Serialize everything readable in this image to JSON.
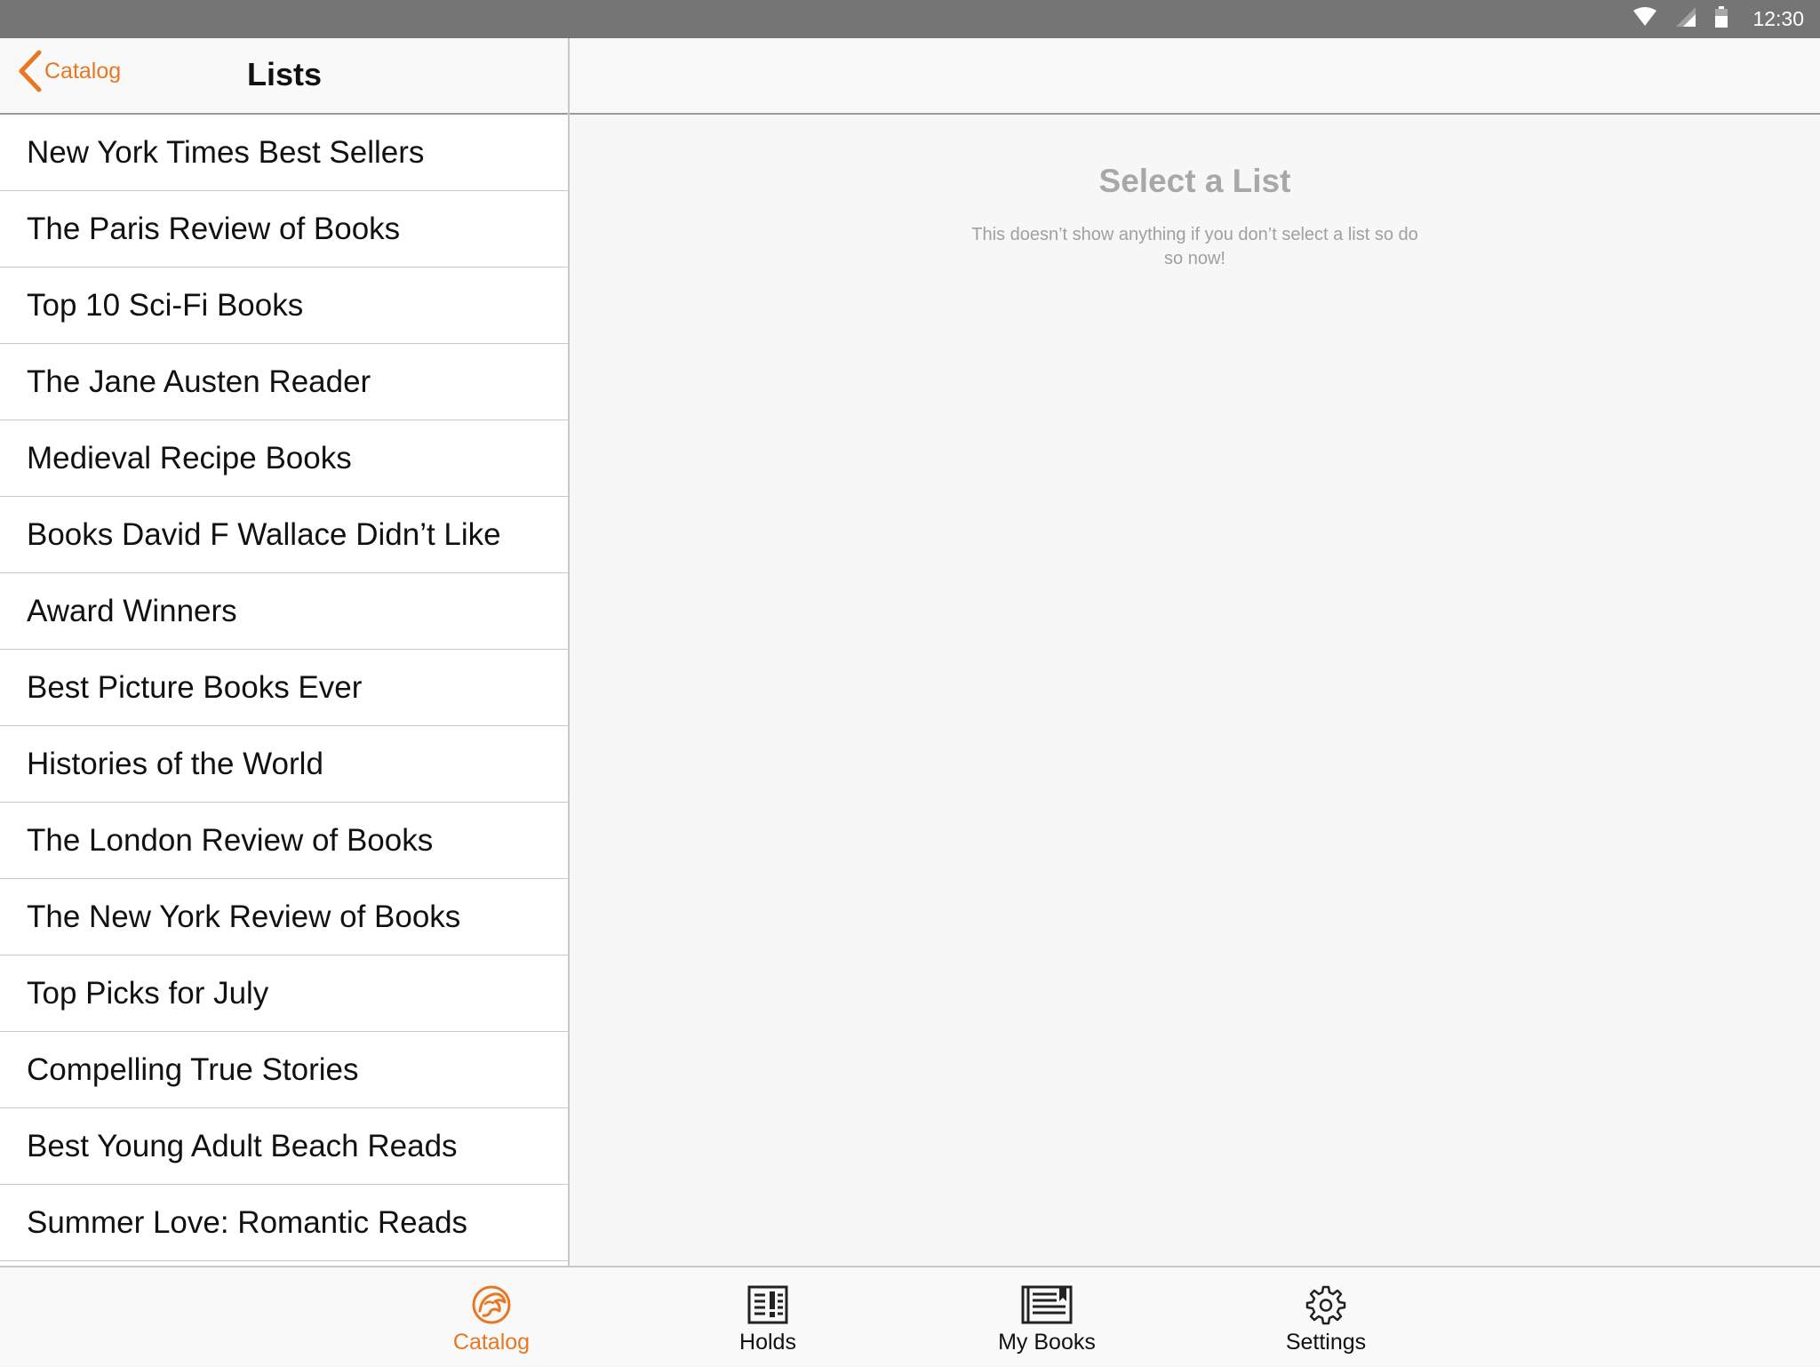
{
  "status_bar": {
    "time": "12:30",
    "icons": [
      "wifi-icon",
      "cell-signal-icon",
      "battery-icon"
    ]
  },
  "header": {
    "back_label": "Catalog",
    "title": "Lists"
  },
  "lists": [
    "New York Times Best Sellers",
    "The Paris Review of Books",
    "Top 10 Sci-Fi Books",
    "The Jane Austen Reader",
    "Medieval Recipe Books",
    "Books David F Wallace Didn’t Like",
    "Award Winners",
    "Best Picture Books Ever",
    "Histories of the World",
    "The London Review of Books",
    "The New York Review of Books",
    "Top Picks for July",
    "Compelling True Stories",
    "Best Young Adult Beach Reads",
    "Summer Love: Romantic Reads"
  ],
  "empty_state": {
    "title": "Select a List",
    "message": "This doesn’t show anything if you don’t select a list so do so now!"
  },
  "tabs": [
    {
      "label": "Catalog",
      "icon": "catalog-lion-icon",
      "active": true
    },
    {
      "label": "Holds",
      "icon": "holds-icon",
      "active": false
    },
    {
      "label": "My Books",
      "icon": "my-books-icon",
      "active": false
    },
    {
      "label": "Settings",
      "icon": "gear-icon",
      "active": false
    }
  ],
  "colors": {
    "accent": "#e87722",
    "status_bar": "#757575"
  }
}
